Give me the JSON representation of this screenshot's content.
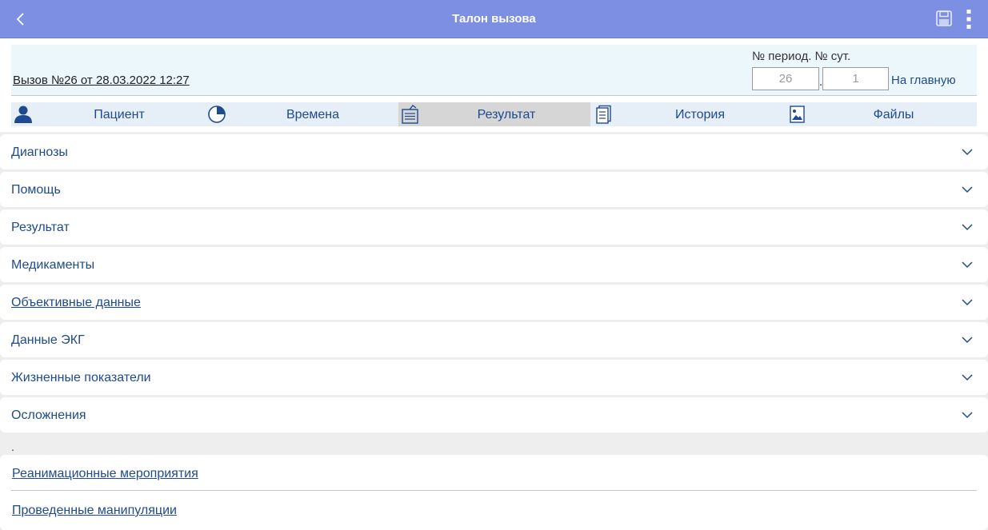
{
  "appbar": {
    "title": "Талон вызова",
    "back_icon": "chevron-left-icon",
    "save_icon": "floppy-disk-icon",
    "menu_icon": "more-vertical-icon"
  },
  "call": {
    "title": "Вызов №26 от 28.03.2022 12:27",
    "period_label": "№ период. № сут.",
    "period_value": "26",
    "day_value": "1",
    "home_link": "На главную"
  },
  "tabs": [
    {
      "label": "Пациент",
      "icon": "person-icon",
      "active": false
    },
    {
      "label": "Времена",
      "icon": "pie-clock-icon",
      "active": false
    },
    {
      "label": "Результат",
      "icon": "clipboard-icon",
      "active": true
    },
    {
      "label": "История",
      "icon": "document-list-icon",
      "active": false
    },
    {
      "label": "Файлы",
      "icon": "image-file-icon",
      "active": false
    }
  ],
  "sections": [
    {
      "label": "Диагнозы",
      "underlined": false
    },
    {
      "label": "Помощь",
      "underlined": false
    },
    {
      "label": "Результат",
      "underlined": false
    },
    {
      "label": "Медикаменты",
      "underlined": false
    },
    {
      "label": "Объективные данные",
      "underlined": true
    },
    {
      "label": "Данные ЭКГ",
      "underlined": false
    },
    {
      "label": "Жизненные показатели",
      "underlined": false
    },
    {
      "label": "Осложнения",
      "underlined": false
    }
  ],
  "separator_text": ".",
  "bottom_links": [
    "Реанимационные мероприятия",
    "Проведенные манипуляции"
  ],
  "colors": {
    "appbar": "#7d8fe2",
    "link_text": "#1e4a8e",
    "info_background": "#ecf7fb",
    "tab_background": "#e6eef8",
    "active_tab": "#d6d6d6"
  }
}
